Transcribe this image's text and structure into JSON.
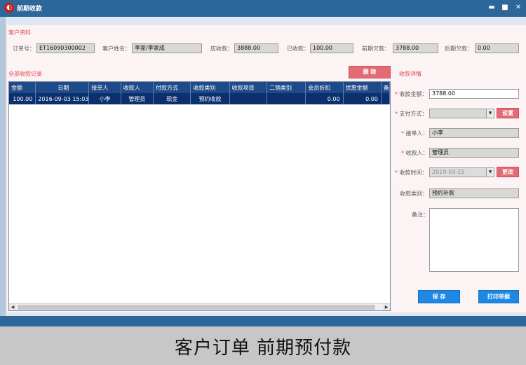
{
  "window": {
    "title": "前期收款",
    "min": "▬",
    "max": "■",
    "close": "✕"
  },
  "customer": {
    "section_title": "客户资料",
    "order_no_label": "订单号：",
    "order_no": "ET16090300002",
    "name_label": "客户姓名：",
    "name": "李家/李家成",
    "receivable_label": "应收款：",
    "receivable": "3888.00",
    "received_label": "已收款：",
    "received": "100.00",
    "prior_due_label": "前期欠款：",
    "prior_due": "3788.00",
    "later_due_label": "后期欠款：",
    "later_due": "0.00"
  },
  "records": {
    "section_title": "全部收款记录",
    "delete_button": "删  除",
    "columns": [
      "金额",
      "日期",
      "接单人",
      "收款人",
      "付款方式",
      "收款类别",
      "收款项目",
      "二销类别",
      "会员折扣",
      "优惠金额",
      "备"
    ],
    "rows": [
      {
        "amount": "100.00",
        "date": "2016-09-03 15:03",
        "taker": "小李",
        "payee": "管理员",
        "method": "现金",
        "category": "预约收款",
        "item": "",
        "resale": "",
        "member_discount": "0.00",
        "promo": "0.00",
        "note": ""
      }
    ]
  },
  "detail": {
    "section_title": "收款详情",
    "amount_label": "收款金额：",
    "amount": "3788.00",
    "pay_method_label": "支付方式：",
    "pay_method": "",
    "setup_button": "设置",
    "taker_label": "接单人：",
    "taker": "小李",
    "payee_label": "收款人：",
    "payee": "管理员",
    "time_label": "收款时间：",
    "time": "2019-03-15",
    "change_button": "更改",
    "category_label": "收款类别：",
    "category": "预约补款",
    "note_label": "备注：",
    "note": "",
    "save_button": "保  存",
    "print_button": "打印单据"
  },
  "caption": "客户订单 前期预付款",
  "colors": {
    "titlebar": "#2d6699",
    "accent_red": "#e04a52",
    "grid_header": "#1e4a8a",
    "grid_selected": "#0c2f6e",
    "button_blue": "#1e88e5",
    "button_pink": "#e46b74"
  }
}
